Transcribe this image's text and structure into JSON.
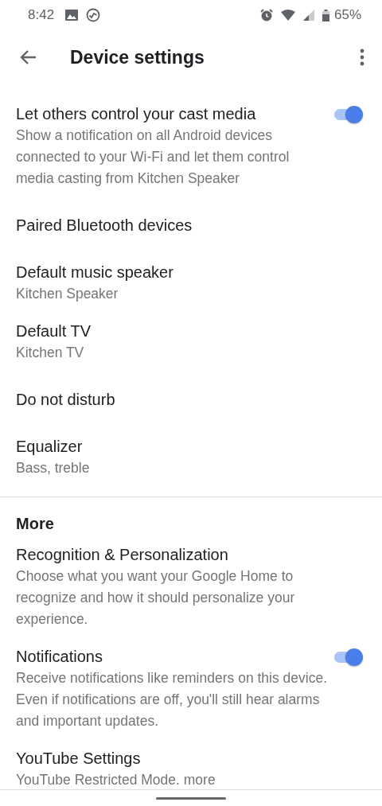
{
  "status_bar": {
    "time": "8:42",
    "battery": "65%"
  },
  "app_bar": {
    "title": "Device settings"
  },
  "items": [
    {
      "kind": "setting",
      "title": "Let others control your cast media",
      "subtitle": "Show a notification on all Android devices connected to your Wi-Fi and let them control media casting from Kitchen Speaker",
      "on": true
    },
    {
      "kind": "setting",
      "title": "Paired Bluetooth devices"
    },
    {
      "kind": "setting",
      "title": "Default music speaker",
      "subtitle": "Kitchen Speaker"
    },
    {
      "kind": "setting",
      "title": "Default TV",
      "subtitle": "Kitchen TV"
    },
    {
      "kind": "setting",
      "title": "Do not disturb"
    },
    {
      "kind": "setting",
      "title": "Equalizer",
      "subtitle": "Bass, treble"
    },
    {
      "kind": "header",
      "title": "More"
    },
    {
      "kind": "setting",
      "title": "Recognition & Personalization",
      "subtitle": "Choose what you want your Google Home to recognize and how it should personalize your experience."
    },
    {
      "kind": "setting",
      "title": "Notifications",
      "subtitle": "Receive notifications like reminders on this device. Even if notifications are off, you'll still hear alarms and important updates.",
      "on": true
    },
    {
      "kind": "setting",
      "title": "YouTube Settings",
      "subtitle": "YouTube Restricted Mode. more"
    }
  ]
}
